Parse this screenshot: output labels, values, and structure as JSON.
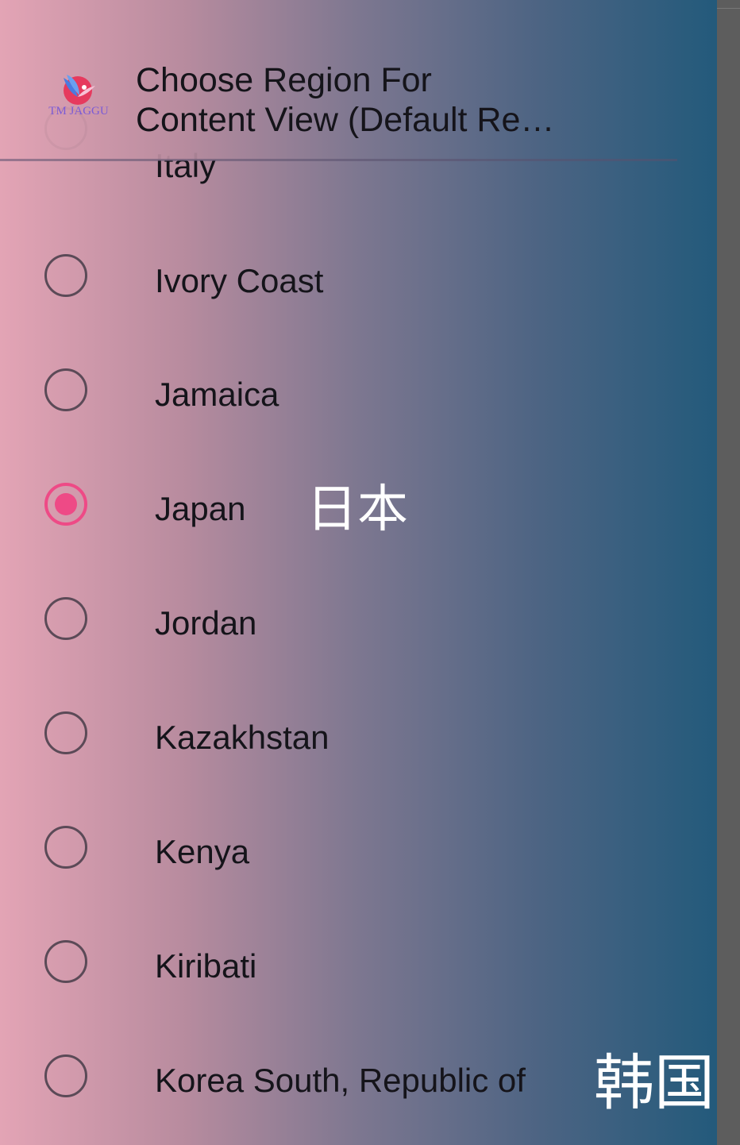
{
  "header": {
    "logo_text": "TM JAGGU",
    "title_line1": "Choose Region For",
    "title_line2": "Content View (Default Re…"
  },
  "regions": [
    {
      "label": "Italy",
      "selected": false,
      "native": ""
    },
    {
      "label": "Ivory Coast",
      "selected": false,
      "native": ""
    },
    {
      "label": "Jamaica",
      "selected": false,
      "native": ""
    },
    {
      "label": "Japan",
      "selected": true,
      "native": "日本"
    },
    {
      "label": "Jordan",
      "selected": false,
      "native": ""
    },
    {
      "label": "Kazakhstan",
      "selected": false,
      "native": ""
    },
    {
      "label": "Kenya",
      "selected": false,
      "native": ""
    },
    {
      "label": "Kiribati",
      "selected": false,
      "native": ""
    },
    {
      "label": "Korea South, Republic of",
      "selected": false,
      "native": "韩国"
    }
  ],
  "colors": {
    "accent": "#ee4a86",
    "radio_border": "#5b4a57",
    "text": "#15141a",
    "gradient_left": "#e3a4b5",
    "gradient_right": "#235a7b"
  }
}
